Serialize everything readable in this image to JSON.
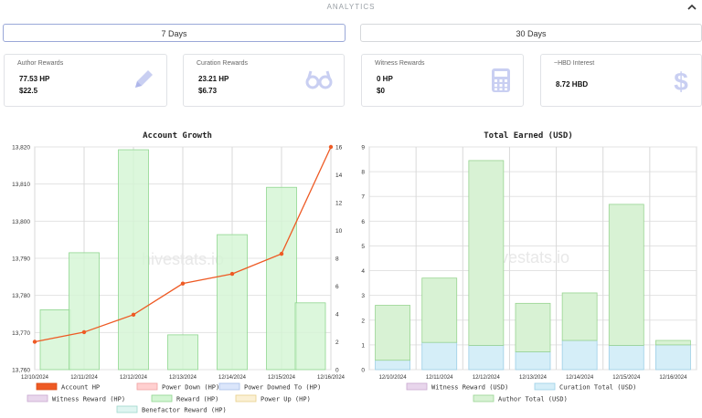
{
  "header": {
    "title": "ANALYTICS"
  },
  "tabs": [
    {
      "label": "7 Days"
    },
    {
      "label": "30 Days"
    }
  ],
  "cards": {
    "author": {
      "title": "Author Rewards",
      "hp": "77.53 HP",
      "usd": "$22.5"
    },
    "curation": {
      "title": "Curation Rewards",
      "hp": "23.21 HP",
      "usd": "$6.73"
    },
    "witness": {
      "title": "Witness Rewards",
      "hp": "0 HP",
      "usd": "$0"
    },
    "interest": {
      "title": "~HBD Interest",
      "value": "8.72 HBD"
    }
  },
  "watermark": "hivestats.io",
  "colors": {
    "account_hp": "#ee5a24",
    "power_down": "#ffd0d0",
    "power_downed_to": "#dbe6fb",
    "witness_reward": "#e8d6ec",
    "reward": "#d3f5d3",
    "power_up": "#fbf0d4",
    "benefactor": "#dff5f1",
    "curation_total": "#d5eef8",
    "author_total": "#d8f2d4"
  },
  "chart_data": [
    {
      "type": "bar",
      "title": "Account Growth",
      "categories": [
        "12/10/2024",
        "12/11/2024",
        "12/12/2024",
        "12/13/2024",
        "12/14/2024",
        "12/15/2024",
        "12/16/2024"
      ],
      "y_left": {
        "ticks": [
          "13,760",
          "13,770",
          "13,780",
          "13,790",
          "13,800",
          "13,810",
          "13,820"
        ],
        "range": [
          13760,
          13820
        ]
      },
      "y_right": {
        "ticks": [
          "0",
          "2",
          "4",
          "6",
          "8",
          "10",
          "12",
          "14",
          "16"
        ],
        "range": [
          0,
          16
        ]
      },
      "series": [
        {
          "name": "Account HP",
          "type": "line",
          "axis": "left",
          "values": [
            13767.5,
            13770.1,
            13774.8,
            13783.2,
            13785.8,
            13791.2,
            13820
          ]
        },
        {
          "name": "Reward (HP)",
          "type": "bar",
          "axis": "right",
          "values": [
            4.3,
            8.4,
            15.8,
            2.5,
            9.7,
            13.1,
            4.8
          ]
        },
        {
          "name": "Power Down (HP)",
          "type": "bar",
          "axis": "right",
          "values": [
            0,
            0,
            0,
            0,
            0,
            0,
            0
          ]
        },
        {
          "name": "Power Downed To (HP)",
          "type": "bar",
          "axis": "right",
          "values": [
            0,
            0,
            0,
            0,
            0,
            0,
            0
          ]
        },
        {
          "name": "Witness Reward (HP)",
          "type": "bar",
          "axis": "right",
          "values": [
            0,
            0,
            0,
            0,
            0,
            0,
            0
          ]
        },
        {
          "name": "Power Up (HP)",
          "type": "bar",
          "axis": "right",
          "values": [
            0,
            0,
            0,
            0,
            0,
            0,
            0
          ]
        },
        {
          "name": "Benefactor Reward (HP)",
          "type": "bar",
          "axis": "right",
          "values": [
            0,
            0,
            0,
            0,
            0,
            0,
            0
          ]
        }
      ],
      "legend": [
        "Account HP",
        "Power Down (HP)",
        "Power Downed To (HP)",
        "Witness Reward (HP)",
        "Reward (HP)",
        "Power Up (HP)",
        "Benefactor Reward (HP)"
      ]
    },
    {
      "type": "bar",
      "stacked": true,
      "title": "Total Earned (USD)",
      "categories": [
        "12/10/2024",
        "12/11/2024",
        "12/12/2024",
        "12/13/2024",
        "12/14/2024",
        "12/15/2024",
        "12/16/2024"
      ],
      "y": {
        "ticks": [
          "0",
          "1",
          "2",
          "3",
          "4",
          "5",
          "6",
          "7",
          "8",
          "9"
        ],
        "range": [
          0,
          9
        ]
      },
      "series": [
        {
          "name": "Witness Reward (USD)",
          "values": [
            0,
            0,
            0,
            0,
            0,
            0,
            0
          ]
        },
        {
          "name": "Curation Total (USD)",
          "values": [
            0.38,
            1.1,
            0.98,
            0.72,
            1.18,
            0.98,
            1.0
          ]
        },
        {
          "name": "Author Total (USD)",
          "values": [
            2.22,
            2.6,
            7.47,
            1.96,
            1.92,
            5.7,
            0.18
          ]
        }
      ],
      "legend": [
        "Witness Reward (USD)",
        "Curation Total (USD)",
        "Author Total (USD)"
      ]
    }
  ]
}
